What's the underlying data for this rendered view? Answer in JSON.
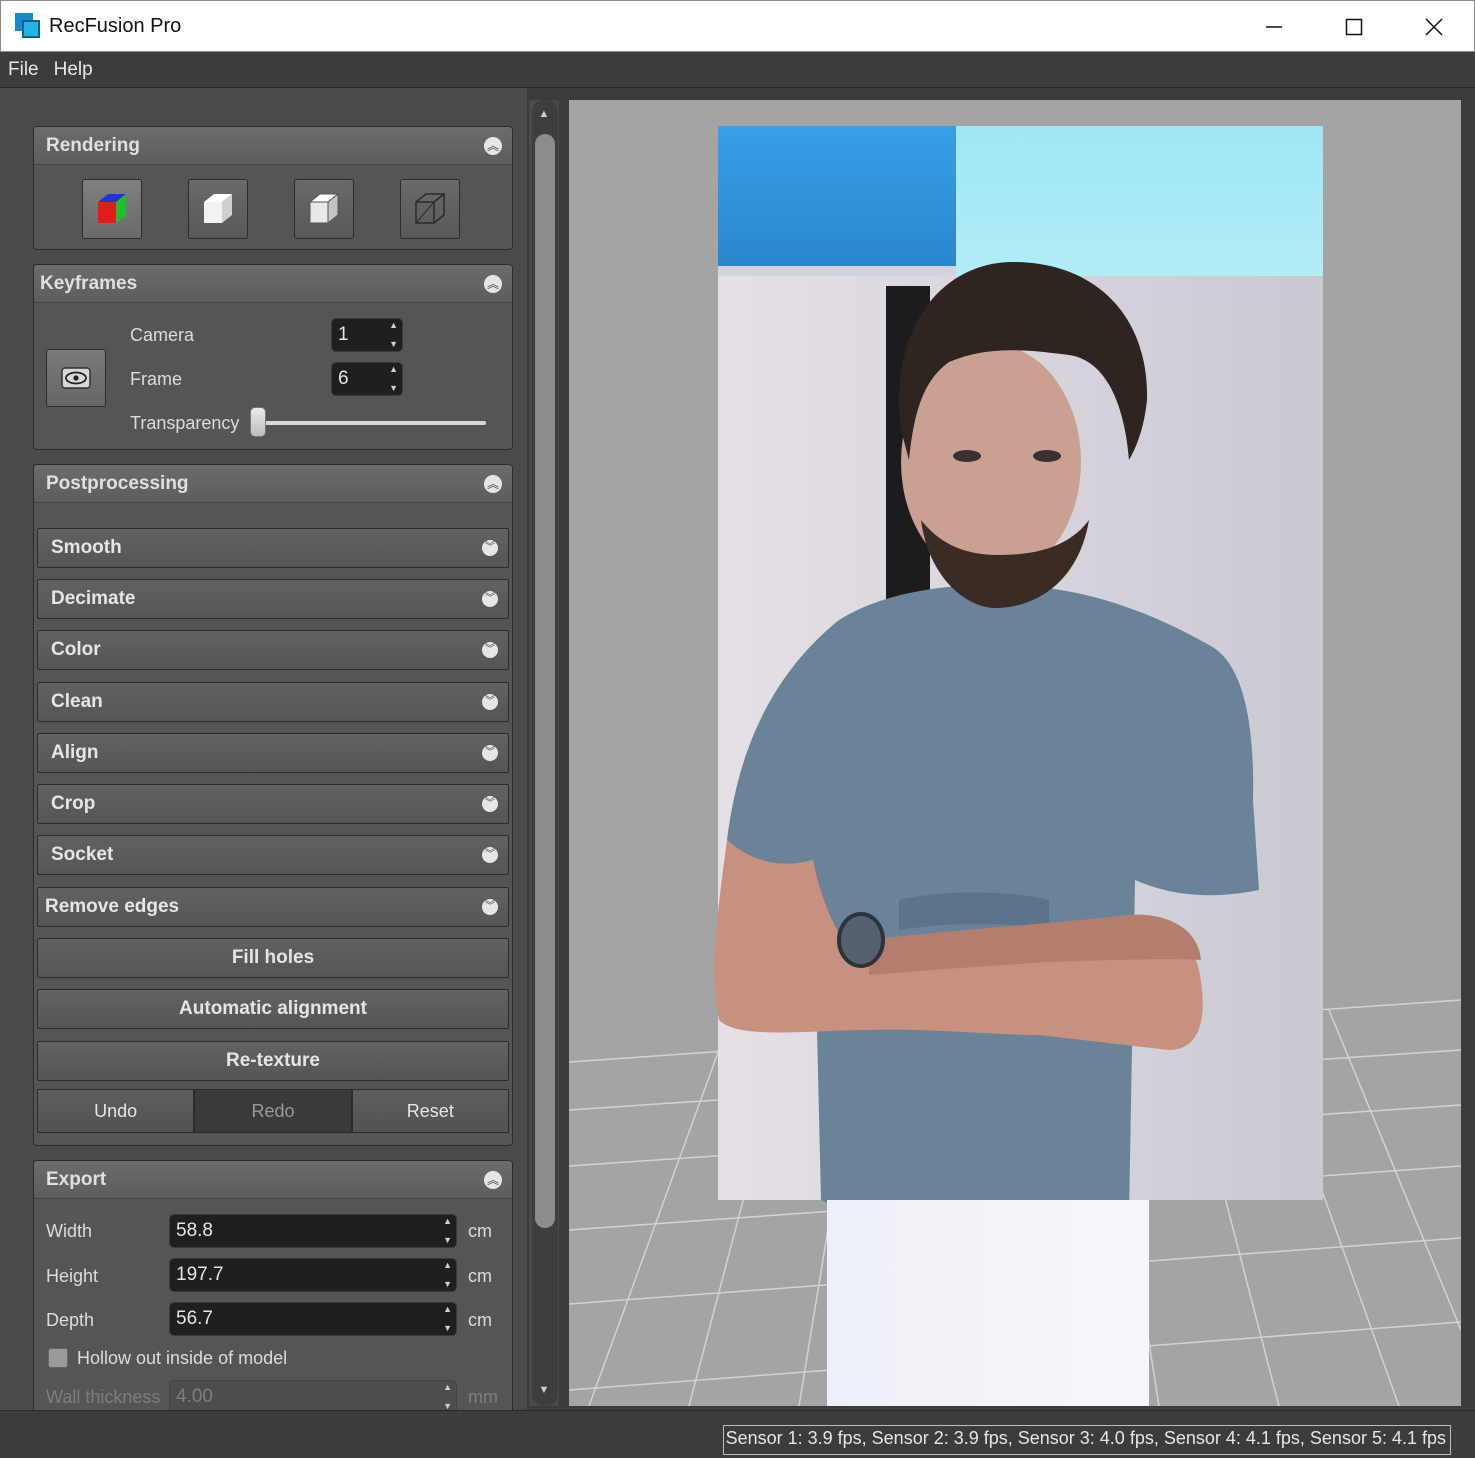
{
  "window": {
    "title": "RecFusion Pro"
  },
  "menu": [
    "File",
    "Help"
  ],
  "rendering": {
    "title": "Rendering",
    "icons": [
      "color-cube-icon",
      "solid-cube-icon",
      "shaded-cube-icon",
      "wireframe-cube-icon"
    ]
  },
  "keyframes": {
    "title": "Keyframes",
    "camera_label": "Camera",
    "camera_value": "1",
    "frame_label": "Frame",
    "frame_value": "6",
    "transparency_label": "Transparency",
    "transparency_value": 0
  },
  "postprocessing": {
    "title": "Postprocessing",
    "sections": [
      "Smooth",
      "Decimate",
      "Color",
      "Clean",
      "Align",
      "Crop",
      "Socket",
      "Remove edges"
    ],
    "actions": [
      "Fill holes",
      "Automatic alignment",
      "Re-texture"
    ],
    "undo": "Undo",
    "redo": "Redo",
    "reset": "Reset"
  },
  "export": {
    "title": "Export",
    "width_label": "Width",
    "width_value": "58.8",
    "width_unit": "cm",
    "height_label": "Height",
    "height_value": "197.7",
    "height_unit": "cm",
    "depth_label": "Depth",
    "depth_value": "56.7",
    "depth_unit": "cm",
    "hollow_label": "Hollow out inside of model",
    "wall_label": "Wall thickness",
    "wall_value": "4.00",
    "wall_unit": "mm"
  },
  "status": {
    "text": "Sensor 1: 3.9 fps, Sensor 2: 3.9 fps, Sensor 3: 4.0 fps, Sensor 4: 4.1 fps, Sensor 5: 4.1 fps"
  },
  "colors": {
    "panel": "#4a4a4a",
    "viewport": "#a4a4a4",
    "accent": "#27b3e8"
  }
}
